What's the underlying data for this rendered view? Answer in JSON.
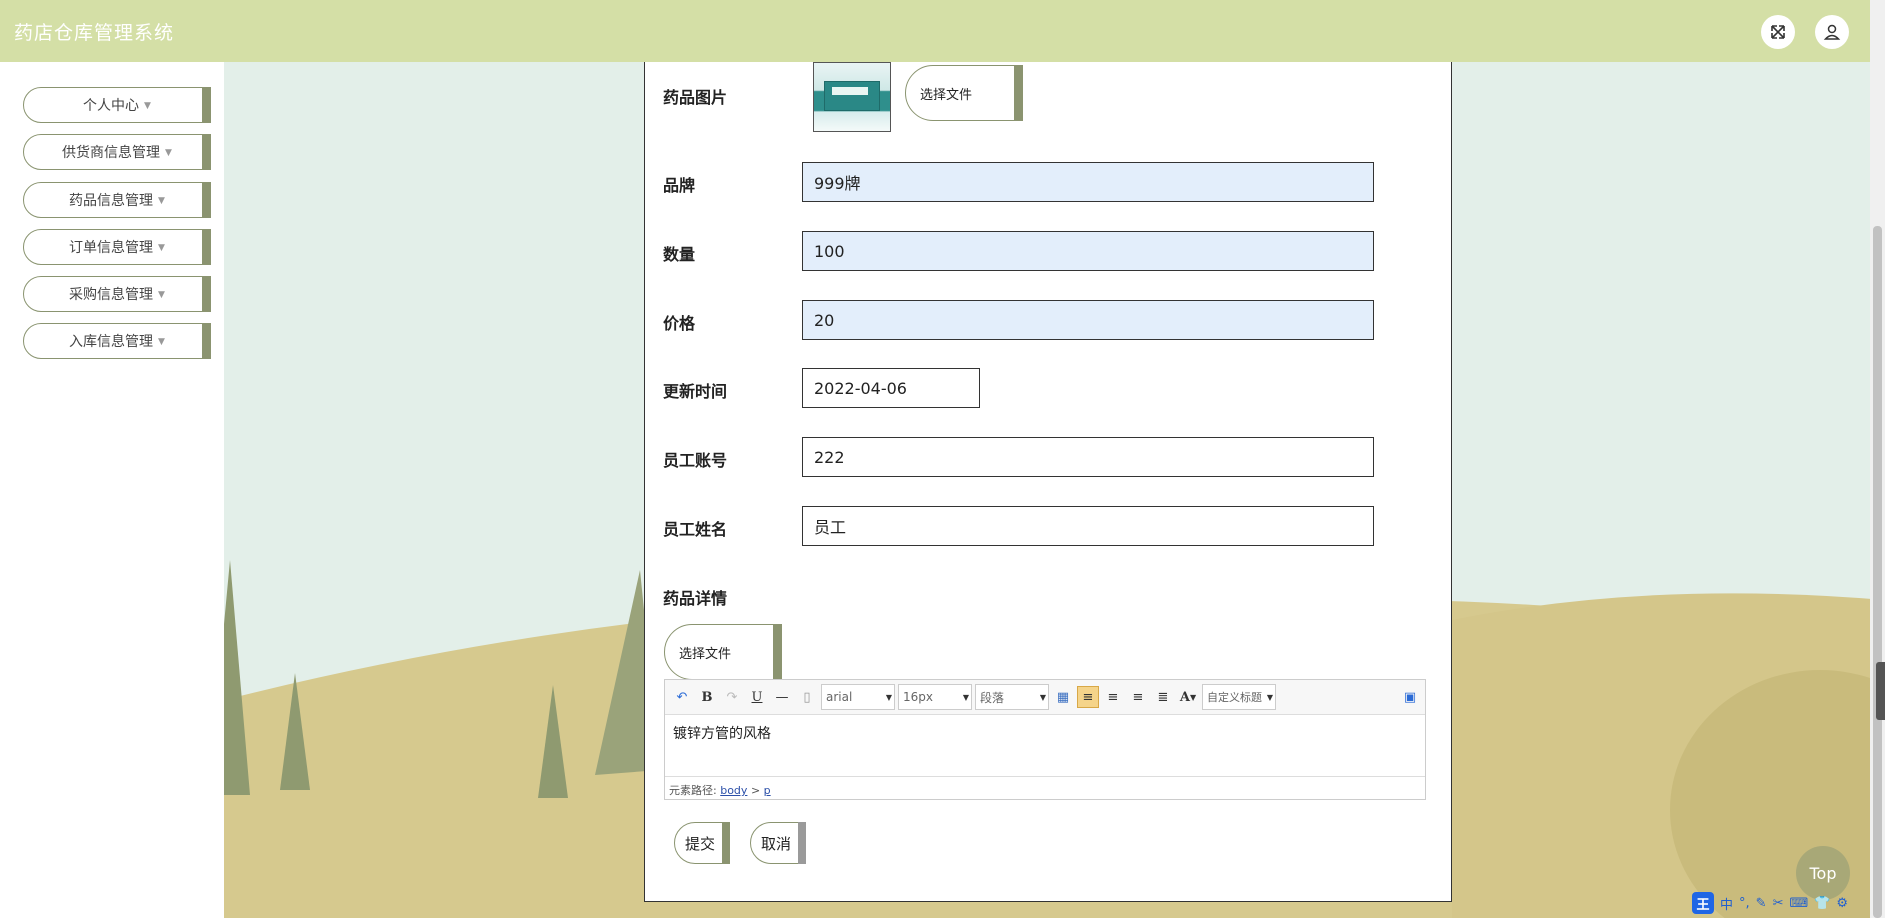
{
  "header": {
    "title": "药店仓库管理系统"
  },
  "sidebar": {
    "items": [
      {
        "label": "个人中心"
      },
      {
        "label": "供货商信息管理"
      },
      {
        "label": "药品信息管理"
      },
      {
        "label": "订单信息管理"
      },
      {
        "label": "采购信息管理"
      },
      {
        "label": "入库信息管理"
      }
    ]
  },
  "form": {
    "image_label": "药品图片",
    "choose_file_label": "选择文件",
    "brand_label": "品牌",
    "brand_value": "999牌",
    "quantity_label": "数量",
    "quantity_value": "100",
    "price_label": "价格",
    "price_value": "20",
    "update_time_label": "更新时间",
    "update_time_value": "2022-04-06",
    "staff_account_label": "员工账号",
    "staff_account_value": "222",
    "staff_name_label": "员工姓名",
    "staff_name_value": "员工",
    "detail_label": "药品详情",
    "detail_choose_file_label": "选择文件"
  },
  "editor": {
    "font_family": "arial",
    "font_size": "16px",
    "paragraph": "段落",
    "custom_title": "自定义标题",
    "content": "镀锌方管的风格",
    "path_label": "元素路径:",
    "path_body": "body",
    "path_sep": ">",
    "path_p": "p"
  },
  "actions": {
    "submit_label": "提交",
    "cancel_label": "取消"
  },
  "top_button_label": "Top",
  "tray": {
    "ime_logo": "王",
    "ime_mode": "中"
  },
  "colors": {
    "header_bg": "#d4dfa6",
    "accent": "#8b9470",
    "field_tint": "#e3eefb"
  }
}
